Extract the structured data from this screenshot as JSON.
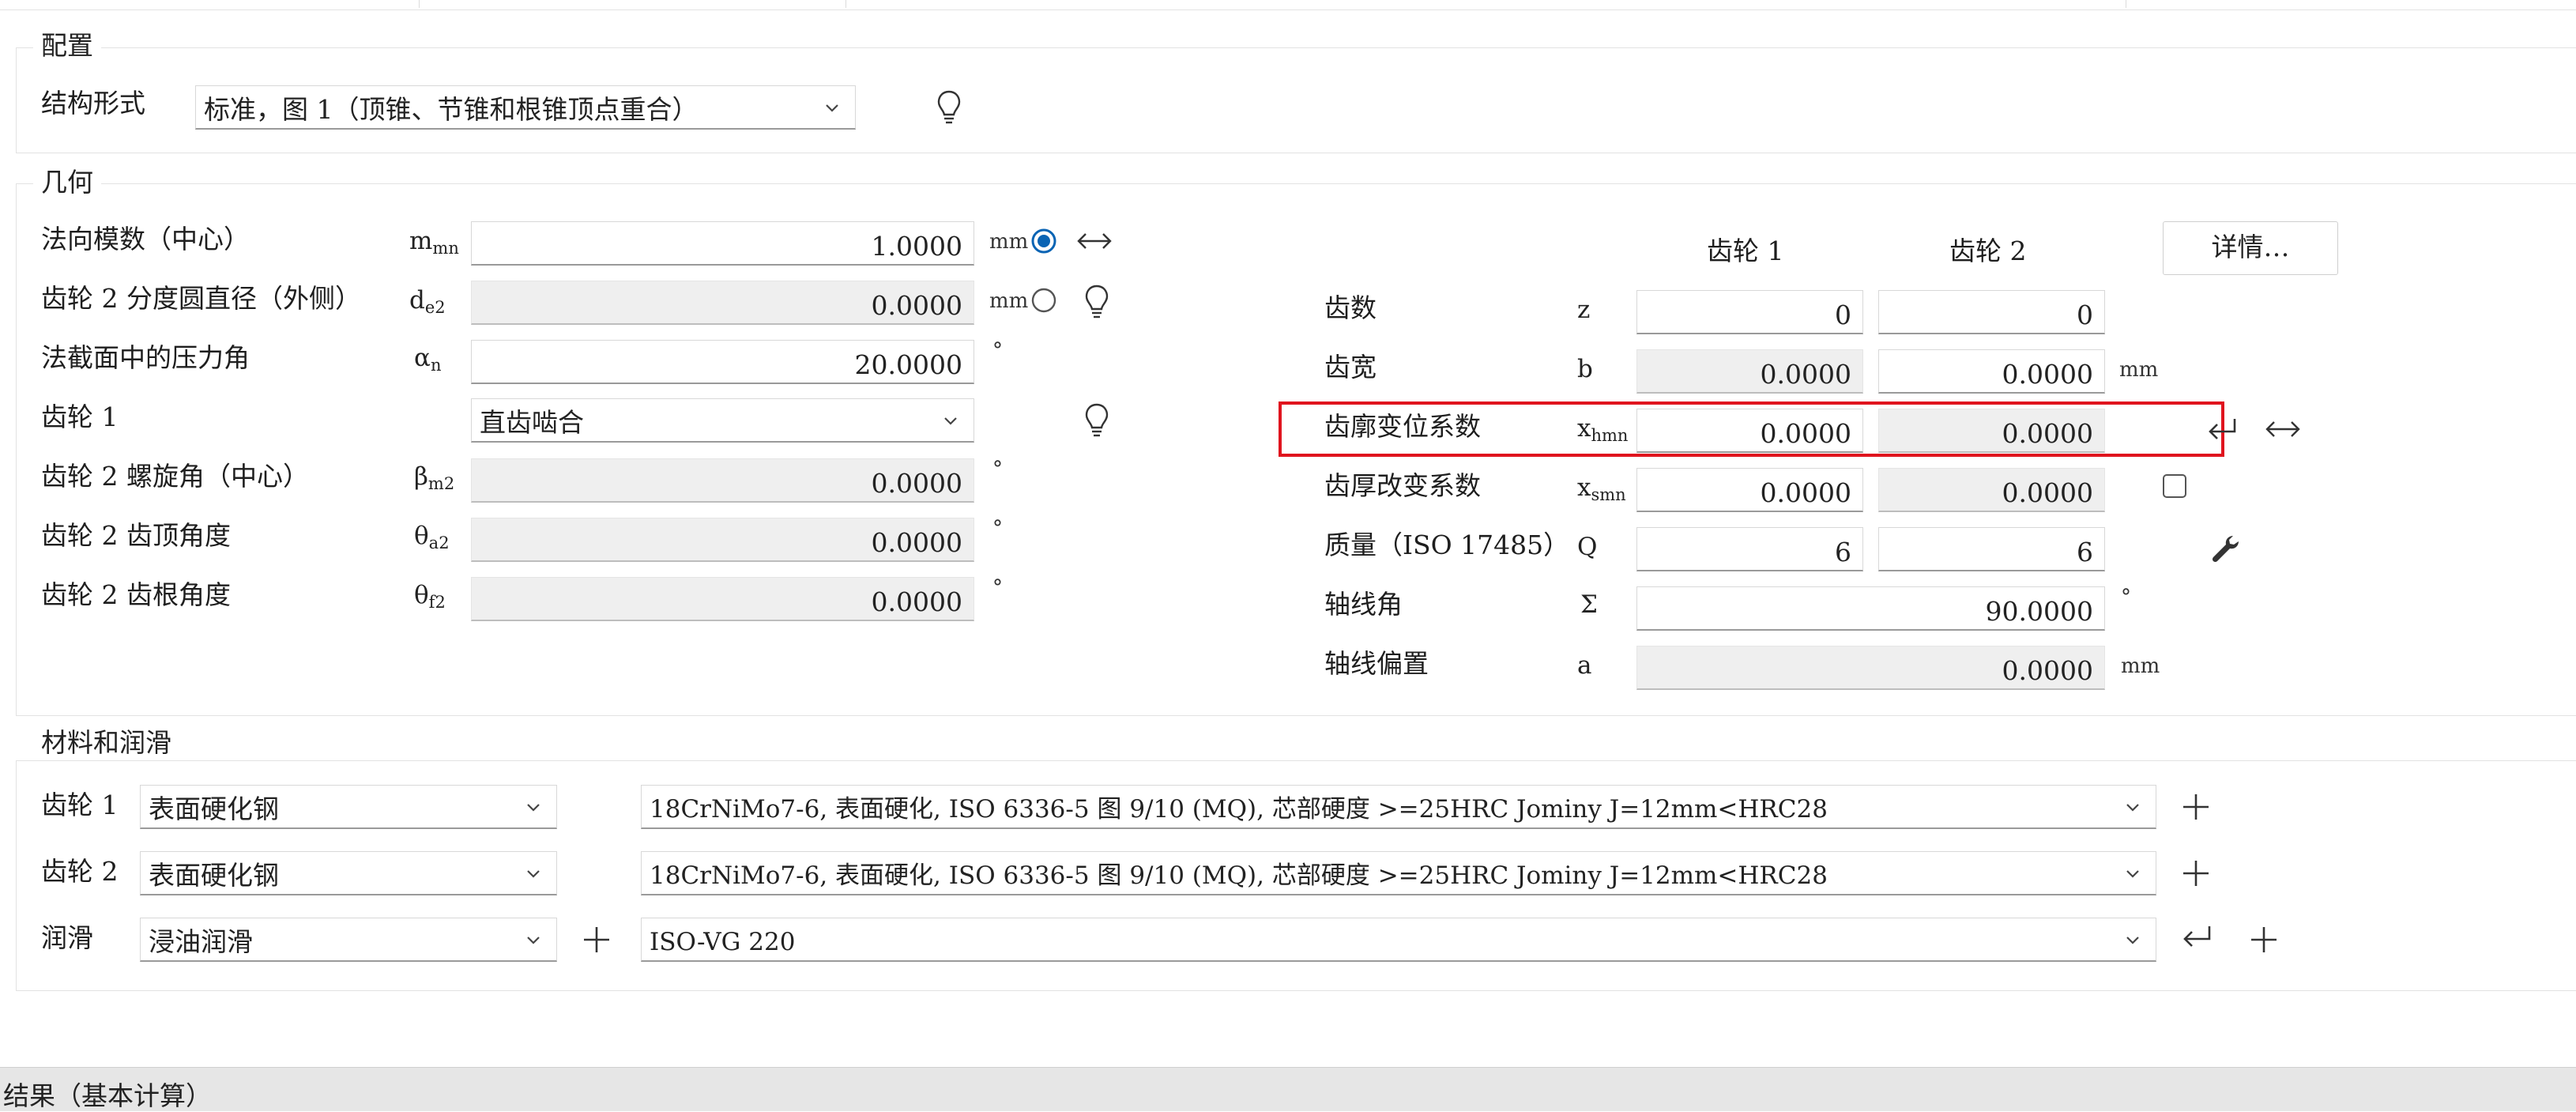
{
  "config": {
    "title": "配置",
    "structure_label": "结构形式",
    "structure_value": "标准，图 1（顶锥、节锥和根锥顶点重合）"
  },
  "geometry": {
    "title": "几何",
    "rows": [
      {
        "label": "法向模数（中心）",
        "sym": "m",
        "sub": "mn",
        "value": "1.0000",
        "unit": "mm"
      },
      {
        "label": "齿轮 2 分度圆直径（外侧）",
        "sym": "d",
        "sub": "e2",
        "value": "0.0000",
        "unit": "mm"
      },
      {
        "label": "法截面中的压力角",
        "sym": "α",
        "sub": "n",
        "value": "20.0000",
        "unit": "°"
      },
      {
        "label": "齿轮 1",
        "value": "直齿啮合"
      },
      {
        "label": "齿轮 2 螺旋角（中心）",
        "sym": "β",
        "sub": "m2",
        "value": "0.0000",
        "unit": "°"
      },
      {
        "label": "齿轮 2 齿顶角度",
        "sym": "θ",
        "sub": "a2",
        "value": "0.0000",
        "unit": "°"
      },
      {
        "label": "齿轮 2 齿根角度",
        "sym": "θ",
        "sub": "f2",
        "value": "0.0000",
        "unit": "°"
      }
    ],
    "gear1_header": "齿轮 1",
    "gear2_header": "齿轮 2",
    "details_button": "详情…",
    "right_rows": [
      {
        "label": "齿数",
        "sym": "z",
        "sub": "",
        "g1": "0",
        "g2": "0",
        "unit": ""
      },
      {
        "label": "齿宽",
        "sym": "b",
        "sub": "",
        "g1": "0.0000",
        "g2": "0.0000",
        "unit": "mm"
      },
      {
        "label": "齿廓变位系数",
        "sym": "x",
        "sub": "hmn",
        "g1": "0.0000",
        "g2": "0.0000",
        "unit": ""
      },
      {
        "label": "齿厚改变系数",
        "sym": "x",
        "sub": "smn",
        "g1": "0.0000",
        "g2": "0.0000",
        "unit": ""
      },
      {
        "label": "质量（ISO 17485）",
        "sym": "Q",
        "sub": "",
        "g1": "6",
        "g2": "6",
        "unit": ""
      },
      {
        "label": "轴线角",
        "sym": "Σ",
        "sub": "",
        "value": "90.0000",
        "unit": "°"
      },
      {
        "label": "轴线偏置",
        "sym": "a",
        "sub": "",
        "value": "0.0000",
        "unit": "mm"
      }
    ]
  },
  "materials": {
    "title": "材料和润滑",
    "rows": [
      {
        "label": "齿轮 1",
        "type": "表面硬化钢",
        "material": "18CrNiMo7-6, 表面硬化, ISO 6336-5 图 9/10 (MQ), 芯部硬度 >=25HRC Jominy J=12mm<HRC28"
      },
      {
        "label": "齿轮 2",
        "type": "表面硬化钢",
        "material": "18CrNiMo7-6, 表面硬化, ISO 6336-5 图 9/10 (MQ), 芯部硬度 >=25HRC Jominy J=12mm<HRC28"
      },
      {
        "label": "润滑",
        "type": "浸油润滑",
        "material": "ISO-VG 220"
      }
    ]
  },
  "results": {
    "title": "结果（基本计算）"
  },
  "colors": {
    "radio_selected": "#0a64b4",
    "highlight": "#e0141e"
  }
}
